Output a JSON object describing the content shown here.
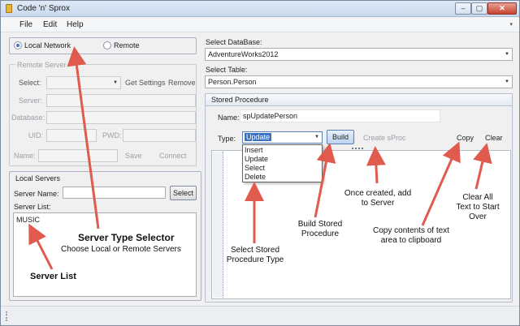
{
  "window": {
    "title": "Code 'n' Sprox",
    "min": "–",
    "max": "▢",
    "close": "✕"
  },
  "menu": {
    "file": "File",
    "edit": "Edit",
    "help": "Help",
    "arrow": "▾"
  },
  "server_type": {
    "local": "Local Network",
    "remote": "Remote",
    "selected": "local"
  },
  "remote_server": {
    "title": "Remote Server",
    "select_label": "Select:",
    "get_settings": "Get Settings",
    "remove": "Remove",
    "server_label": "Server:",
    "database_label": "Database:",
    "uid_label": "UID:",
    "pwd_label": "PWD:",
    "name_label": "Name:",
    "save": "Save",
    "connect": "Connect"
  },
  "local_servers": {
    "title": "Local Servers",
    "server_name_label": "Server Name:",
    "select_button": "Select",
    "server_list_label": "Server List:",
    "items": [
      "MUSIC"
    ]
  },
  "database": {
    "label": "Select DataBase:",
    "value": "AdventureWorks2012",
    "arrow": "▼"
  },
  "table": {
    "label": "Select Table:",
    "value": "Person.Person",
    "arrow": "▼"
  },
  "stored_procedure": {
    "title": "Stored Procedure",
    "name_label": "Name:",
    "name_value": "spUpdatePerson",
    "type_label": "Type:",
    "type_value": "Update",
    "type_options": [
      "Insert",
      "Update",
      "Select",
      "Delete"
    ],
    "build": "Build",
    "create_sproc": "Create sProc",
    "copy": "Copy",
    "clear": "Clear"
  },
  "annotations": {
    "server_type_title": "Server Type Selector",
    "server_type_sub": "Choose Local or Remote Servers",
    "server_list": "Server List",
    "select_type": "Select Stored Procedure Type",
    "build": "Build Stored Procedure",
    "add_server": "Once created, add to Server",
    "copy": "Copy contents of text area to clipboard",
    "clear": "Clear All Text to Start Over"
  },
  "colors": {
    "arrow": "#e05a4e",
    "accent": "#3b73c4"
  }
}
